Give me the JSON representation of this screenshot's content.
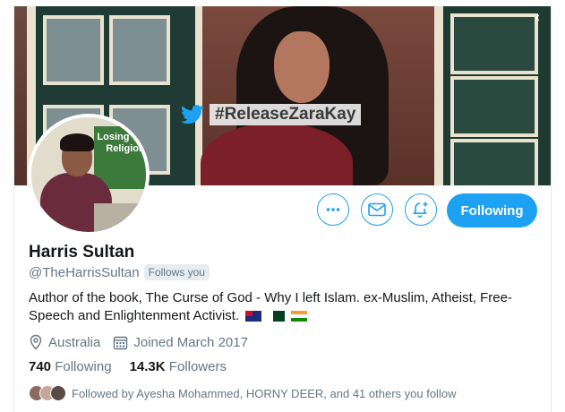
{
  "banner": {
    "hashtag": "#ReleaseZaraKay"
  },
  "avatar": {
    "sign_text": "Losing Your Religion"
  },
  "actions": {
    "more_icon": "more-icon",
    "message_icon": "mail-icon",
    "notify_icon": "bell-plus-icon",
    "follow_label": "Following"
  },
  "profile": {
    "name": "Harris Sultan",
    "handle": "@TheHarrisSultan",
    "follows_you": "Follows you",
    "bio": "Author of the book, The Curse of God - Why I left Islam. ex-Muslim, Atheist, Free-Speech and Enlightenment Activist.",
    "bio_flags": [
      "australia-flag",
      "pakistan-flag",
      "india-flag"
    ],
    "location": "Australia",
    "joined": "Joined March 2017",
    "following_count": "740",
    "following_label": "Following",
    "followers_count": "14.3K",
    "followers_label": "Followers",
    "followed_by": "Followed by Ayesha Mohammed, HORNY DEER, and 41 others you follow"
  },
  "colors": {
    "accent": "#1da1f2",
    "secondary_text": "#657786",
    "primary_text": "#14171a"
  }
}
